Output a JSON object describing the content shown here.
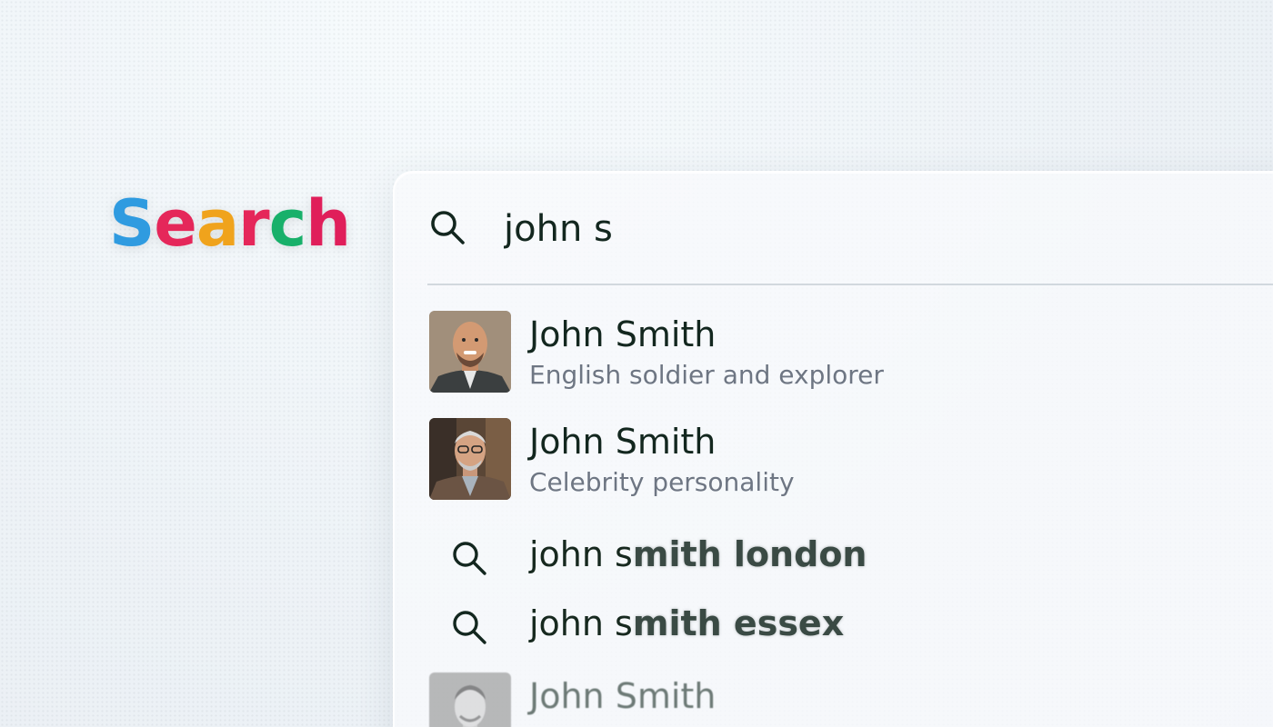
{
  "logo": {
    "letters": [
      {
        "char": "S",
        "color": "#2f9be0"
      },
      {
        "char": "e",
        "color": "#e5275a"
      },
      {
        "char": "a",
        "color": "#f0a31c"
      },
      {
        "char": "r",
        "color": "#e5275a"
      },
      {
        "char": "c",
        "color": "#18b06a"
      },
      {
        "char": "h",
        "color": "#e01e5a"
      }
    ]
  },
  "search": {
    "value": "john s",
    "icon": "search-icon"
  },
  "suggestions": [
    {
      "type": "person",
      "name": "John Smith",
      "description": "English soldier and explorer",
      "avatar": "portrait-smiling-bald-man"
    },
    {
      "type": "person",
      "name": "John Smith",
      "description": "Celebrity personality",
      "avatar": "portrait-older-man-glasses"
    },
    {
      "type": "query",
      "typed": "john s",
      "completion": "mith london",
      "icon": "search-icon"
    },
    {
      "type": "query",
      "typed": "john s",
      "completion": "mith essex",
      "icon": "search-icon"
    },
    {
      "type": "person",
      "name": "John Smith",
      "description": "",
      "avatar": "portrait-man-bw"
    }
  ]
}
